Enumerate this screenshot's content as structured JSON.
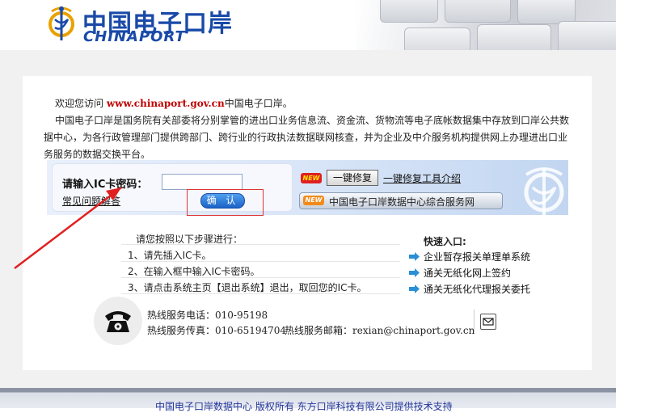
{
  "header": {
    "logo_cn": "中国电子口岸",
    "logo_en": "CHINAPORT",
    "icons": [
      "chinaport-emblem-icon",
      "keyboard-decoration"
    ]
  },
  "intro": {
    "welcome_prefix": "欢迎您访问",
    "url": "www.chinaport.gov.cn",
    "welcome_suffix": "中国电子口岸。",
    "description": "中国电子口岸是国务院有关部委将分别掌管的进出口业务信息流、资金流、货物流等电子底帐数据集中存放到口岸公共数据中心，为各行政管理部门提供跨部门、跨行业的行政执法数据联网核查，并为企业及中介服务机构提供网上办理进出口业务服务的数据交换平台。"
  },
  "login": {
    "password_label": "请输入IC卡密码：",
    "password_value": "",
    "faq_link": "常见问题解答",
    "confirm_button": "确 认",
    "new_badge": "NEW",
    "repair_button": "一键修复",
    "repair_tool_link": "一键修复工具介绍",
    "service_badge": "NEW",
    "service_button": "中国电子口岸数据中心综合服务网"
  },
  "steps": {
    "title": "请您按照以下步骤进行：",
    "items": [
      "1、请先插入IC卡。",
      "2、在输入框中输入IC卡密码。",
      "3、请点击系统主页【退出系统】退出，取回您的IC卡。"
    ]
  },
  "quick_entry": {
    "title": "快速入口:",
    "items": [
      "企业暂存报关单理单系统",
      "通关无纸化网上签约",
      "通关无纸化代理报关委托"
    ]
  },
  "contact": {
    "hotline_label": "热线服务电话：",
    "hotline_value": "010-95198",
    "fax_label": "热线服务传真：",
    "fax_value": "010-65194704",
    "email_label": "热线服务邮箱：",
    "email_value": "rexian@chinaport.gov.cn"
  },
  "footer": {
    "text": "中国电子口岸数据中心 版权所有 东方口岸科技有限公司提供技术支持"
  },
  "colors": {
    "brand_blue": "#1a4aa8",
    "url_red": "#c00000",
    "annotation_red": "#e02020",
    "confirm_blue": "#1c62c6"
  }
}
